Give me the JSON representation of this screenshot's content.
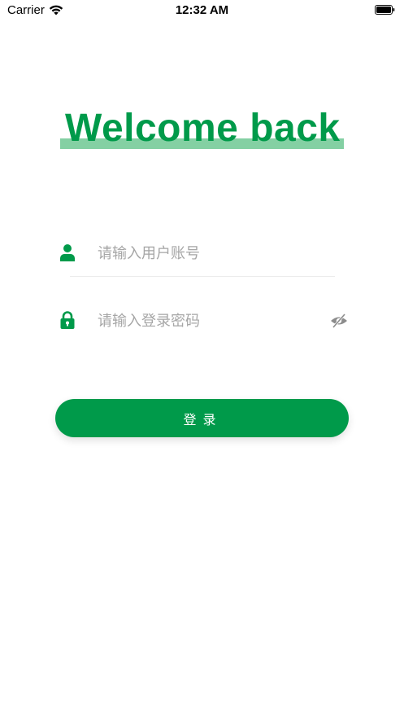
{
  "status_bar": {
    "carrier": "Carrier",
    "time": "12:32 AM",
    "wifi_icon": "wifi-icon",
    "battery_icon": "battery-icon"
  },
  "header": {
    "title": "Welcome back"
  },
  "form": {
    "username": {
      "icon": "user-icon",
      "value": "",
      "placeholder": "请输入用户账号"
    },
    "password": {
      "icon": "lock-icon",
      "value": "",
      "placeholder": "请输入登录密码",
      "visibility_icon": "eye-off-icon"
    },
    "submit_label": "登录"
  },
  "colors": {
    "brand": "#009a4a",
    "highlight": "#84d0a3",
    "placeholder": "#a6a6a6"
  }
}
